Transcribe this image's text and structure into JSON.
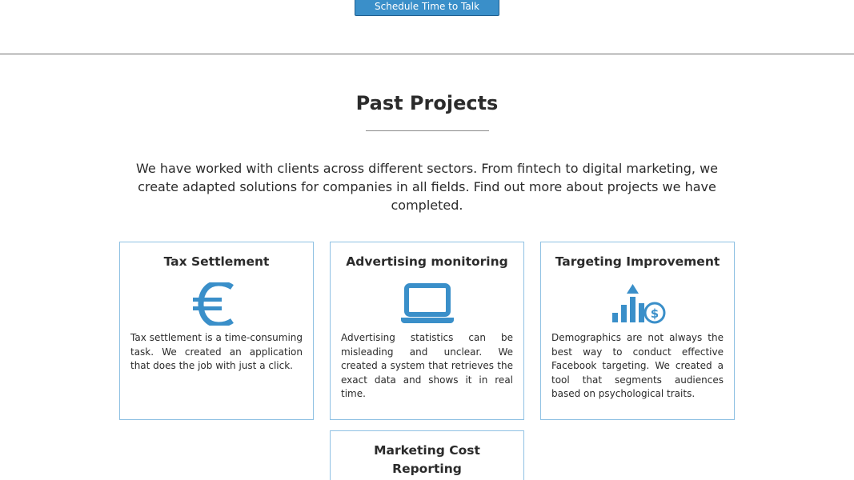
{
  "hero": {
    "cta_label": "Schedule Time to Talk"
  },
  "projects": {
    "title": "Past Projects",
    "intro": "We have worked with clients across different sectors. From fintech to digital marketing, we create adapted solutions for companies in all fields. Find out more about projects we have completed.",
    "cards": [
      {
        "title": "Tax Settlement",
        "icon": "euro-icon",
        "text": "Tax settlement is a time-consuming task. We created an application that does the job with just a click."
      },
      {
        "title": "Advertising monitoring",
        "icon": "laptop-icon",
        "text": "Advertising statistics can be misleading and unclear. We created a system that retrieves the exact data and shows it in real time."
      },
      {
        "title": "Targeting Improvement",
        "icon": "growth-chart-dollar-icon",
        "text": "Demographics are not always the best way to conduct effective Facebook targeting. We created a tool that segments audiences based on psychological traits."
      },
      {
        "title": "Marketing Cost Reporting",
        "icon": "",
        "text": ""
      }
    ]
  },
  "colors": {
    "accent": "#3a8fc9",
    "card_border": "#8fc1e3",
    "text": "#2b2b2b"
  }
}
